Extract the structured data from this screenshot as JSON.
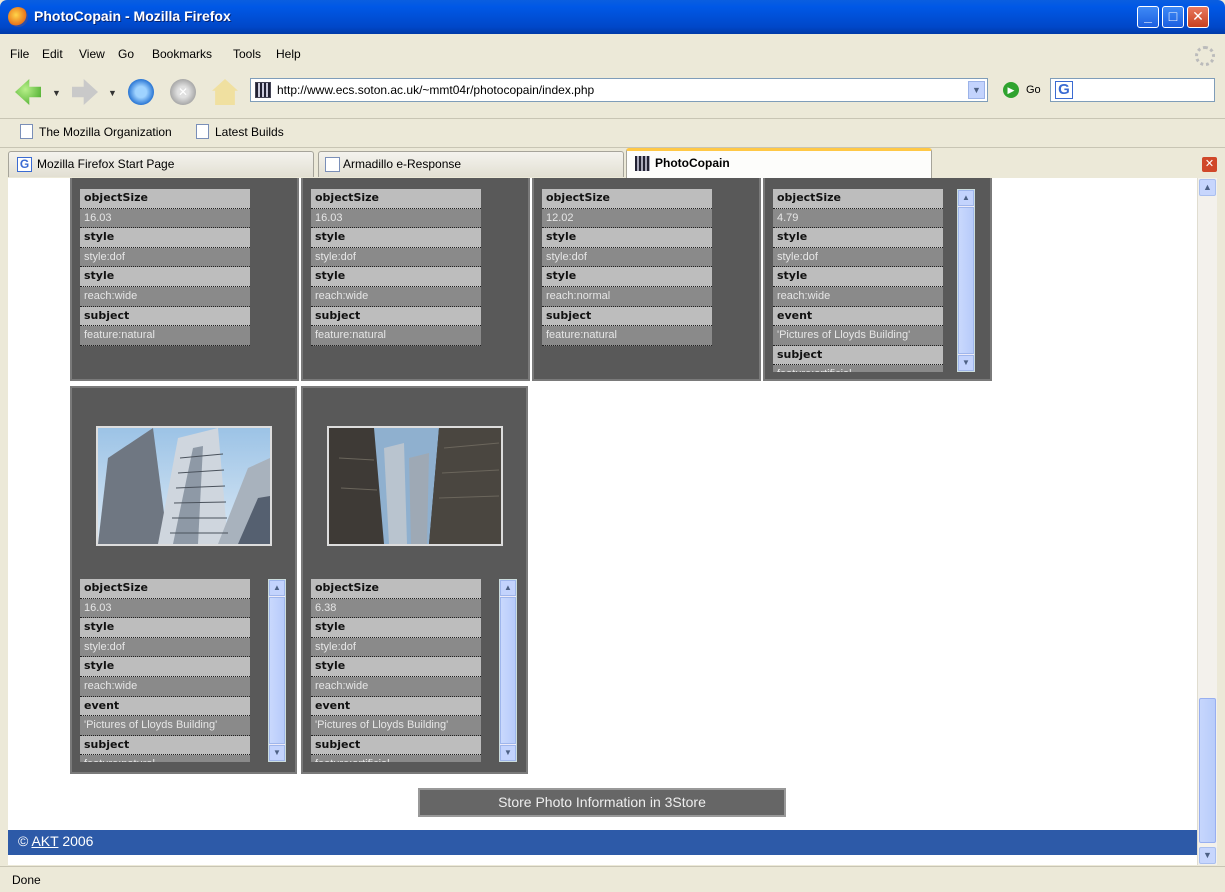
{
  "window": {
    "title": "PhotoCopain - Mozilla Firefox"
  },
  "menu": [
    "File",
    "Edit",
    "View",
    "Go",
    "Bookmarks",
    "Tools",
    "Help"
  ],
  "nav": {
    "url": "http://www.ecs.soton.ac.uk/~mmt04r/photocopain/index.php",
    "go_label": "Go"
  },
  "bookmarks": [
    "The Mozilla Organization",
    "Latest Builds"
  ],
  "tabs": [
    "Mozilla Firefox Start Page",
    "Armadillo e-Response",
    "PhotoCopain"
  ],
  "cards_top": [
    {
      "props": [
        [
          "objectSize",
          "16.03"
        ],
        [
          "style",
          "style:dof"
        ],
        [
          "style",
          "reach:wide"
        ],
        [
          "subject",
          "feature:natural"
        ]
      ]
    },
    {
      "props": [
        [
          "objectSize",
          "16.03"
        ],
        [
          "style",
          "style:dof"
        ],
        [
          "style",
          "reach:wide"
        ],
        [
          "subject",
          "feature:natural"
        ]
      ]
    },
    {
      "props": [
        [
          "objectSize",
          "12.02"
        ],
        [
          "style",
          "style:dof"
        ],
        [
          "style",
          "reach:normal"
        ],
        [
          "subject",
          "feature:natural"
        ]
      ]
    },
    {
      "props": [
        [
          "objectSize",
          "4.79"
        ],
        [
          "style",
          "style:dof"
        ],
        [
          "style",
          "reach:wide"
        ],
        [
          "event",
          "'Pictures of Lloyds Building'"
        ],
        [
          "subject",
          "feature:artificial"
        ]
      ]
    }
  ],
  "cards_bottom": [
    {
      "props": [
        [
          "objectSize",
          "16.03"
        ],
        [
          "style",
          "style:dof"
        ],
        [
          "style",
          "reach:wide"
        ],
        [
          "event",
          "'Pictures of Lloyds Building'"
        ],
        [
          "subject",
          "feature:natural"
        ]
      ]
    },
    {
      "props": [
        [
          "objectSize",
          "6.38"
        ],
        [
          "style",
          "style:dof"
        ],
        [
          "style",
          "reach:wide"
        ],
        [
          "event",
          "'Pictures of Lloyds Building'"
        ],
        [
          "subject",
          "feature:artificial"
        ]
      ]
    }
  ],
  "store_button": "Store Photo Information in 3Store",
  "footer": {
    "copyright": "©",
    "link": "AKT",
    "year": "2006"
  },
  "status": "Done"
}
